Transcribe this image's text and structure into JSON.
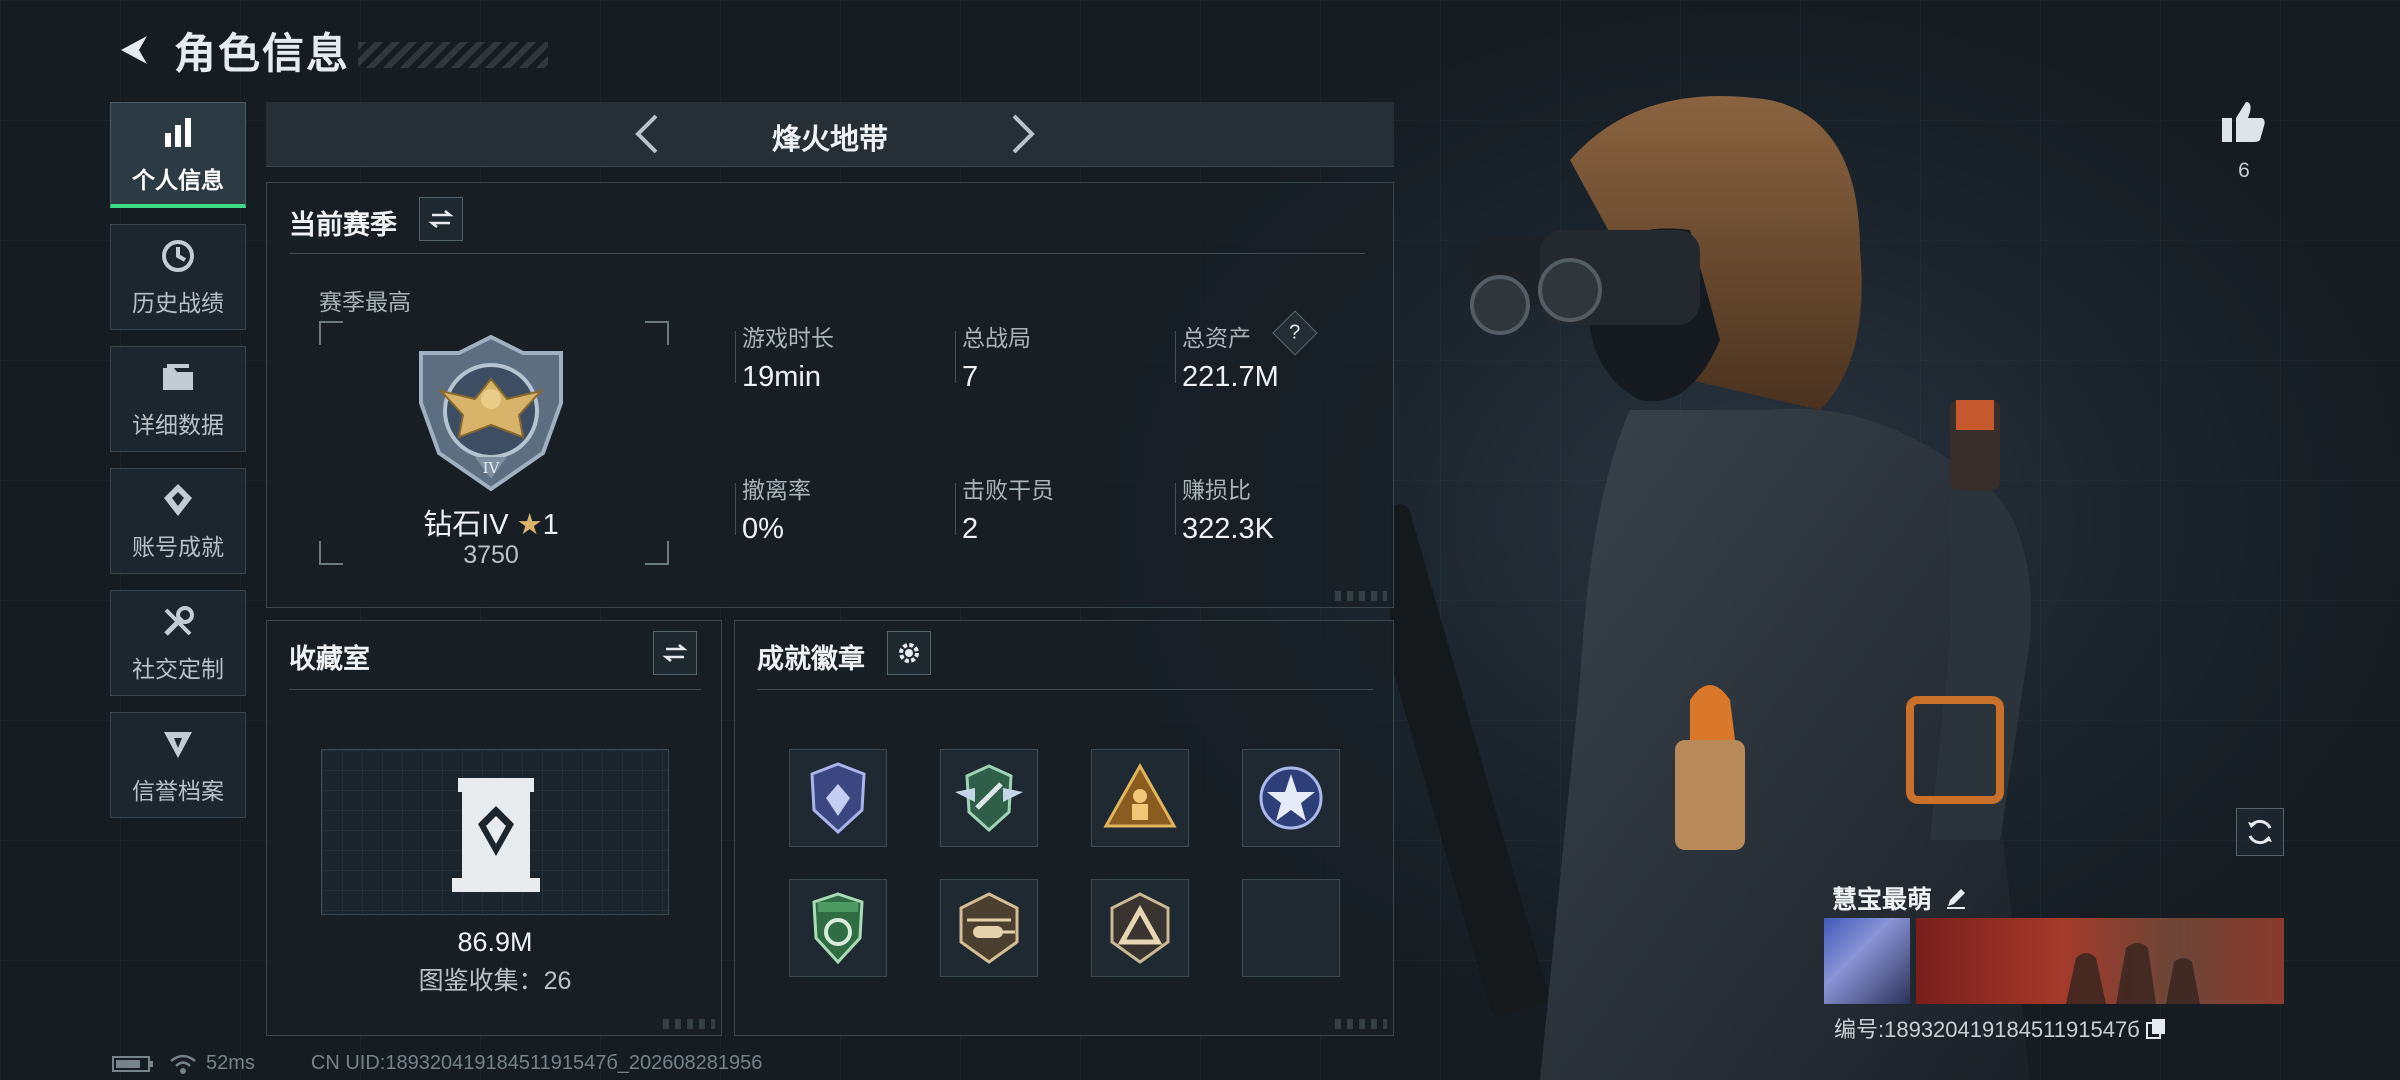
{
  "header": {
    "title": "角色信息"
  },
  "nav": [
    {
      "label": "个人信息",
      "icon": "bar-chart-icon",
      "active": true
    },
    {
      "label": "历史战绩",
      "icon": "history-icon",
      "active": false
    },
    {
      "label": "详细数据",
      "icon": "folder-icon",
      "active": false
    },
    {
      "label": "账号成就",
      "icon": "achievement-icon",
      "active": false
    },
    {
      "label": "社交定制",
      "icon": "tools-icon",
      "active": false
    },
    {
      "label": "信誉档案",
      "icon": "credit-icon",
      "active": false
    }
  ],
  "mode_selector": {
    "label": "烽火地带"
  },
  "season": {
    "title": "当前赛季",
    "best_label": "赛季最高",
    "rank_name": "钻石IV",
    "rank_stars": "1",
    "rank_score": "3750",
    "rank_numeral": "IV",
    "stats": [
      {
        "label": "游戏时长",
        "value": "19min"
      },
      {
        "label": "总战局",
        "value": "7"
      },
      {
        "label": "总资产",
        "value": "221.7M",
        "help": "?"
      },
      {
        "label": "撤离率",
        "value": "0%"
      },
      {
        "label": "击败干员",
        "value": "2"
      },
      {
        "label": "赚损比",
        "value": "322.3K"
      }
    ]
  },
  "collection": {
    "title": "收藏室",
    "value": "86.9M",
    "codex_text": "图鉴收集：26"
  },
  "badges": {
    "title": "成就徽章",
    "items": [
      {
        "icon": "purple-shield-badge-icon",
        "color": "#7d8bd6"
      },
      {
        "icon": "winged-shield-badge-icon",
        "color": "#5fa07c"
      },
      {
        "icon": "triangle-soldier-badge-icon",
        "color": "#d2a24c"
      },
      {
        "icon": "star-badge-icon",
        "color": "#8a9ad8"
      },
      {
        "icon": "green-shield-badge-icon",
        "color": "#4f9a63"
      },
      {
        "icon": "helicopter-badge-icon",
        "color": "#b89a6a"
      },
      {
        "icon": "triangle-badge-icon",
        "color": "#b8a585"
      },
      {
        "icon": "empty-slot",
        "color": ""
      }
    ]
  },
  "like": {
    "count": "6"
  },
  "player": {
    "name": "慧宝最萌",
    "id_text": "编号:18932041918451191547б"
  },
  "status_bar": {
    "ping": "52ms",
    "uid": "CN UID:18932041918451191547б_202608281956"
  },
  "colors": {
    "accent": "#3ddc84",
    "panel_border": "#3a474f"
  }
}
